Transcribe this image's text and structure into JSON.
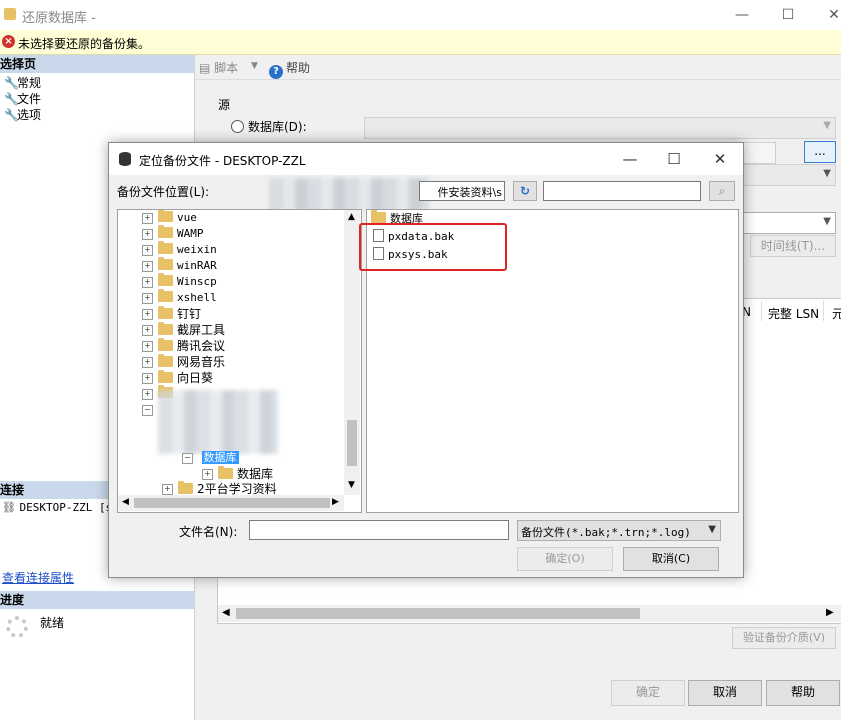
{
  "window": {
    "title": "还原数据库 -",
    "minimize": "—",
    "maximize": "☐",
    "close": "✕"
  },
  "message": {
    "text": "未选择要还原的备份集。"
  },
  "left": {
    "select_page": "选择页",
    "nav": [
      {
        "label": "常规"
      },
      {
        "label": "文件"
      },
      {
        "label": "选项"
      }
    ],
    "connection": "连接",
    "server": "DESKTOP-ZZL [s",
    "view_conn_props": "查看连接属性",
    "progress": "进度",
    "status": "就绪"
  },
  "toolbar": {
    "script": "脚本",
    "help": "帮助"
  },
  "source": {
    "label": "源",
    "database_radio": "数据库(D):",
    "browse": "...",
    "timeline": "时间线(T)...",
    "col_n": "N",
    "col_full_lsn": "完整 LSN",
    "col_more": "元",
    "verify": "验证备份介质(V)"
  },
  "footer": {
    "ok": "确定",
    "cancel": "取消",
    "help": "帮助"
  },
  "dialog": {
    "title": "定位备份文件 - DESKTOP-ZZL",
    "location_label": "备份文件位置(L):",
    "path": "件安装资料\\s",
    "tree": [
      {
        "label": "vue",
        "mono": true
      },
      {
        "label": "WAMP",
        "mono": true
      },
      {
        "label": "weixin",
        "mono": true
      },
      {
        "label": "winRAR",
        "mono": true
      },
      {
        "label": "Winscp",
        "mono": true
      },
      {
        "label": "xshell",
        "mono": true
      },
      {
        "label": "钉钉",
        "mono": false
      },
      {
        "label": "截屏工具",
        "mono": false
      },
      {
        "label": "腾讯会议",
        "mono": false
      },
      {
        "label": "网易音乐",
        "mono": false
      },
      {
        "label": "向日葵",
        "mono": false
      }
    ],
    "selected_node": "数据库",
    "child_node": "数据库",
    "sibling_node": "2平台学习资料",
    "list_header": "数据库",
    "files": [
      "pxdata.bak",
      "pxsys.bak"
    ],
    "filename_label": "文件名(N):",
    "filename_value": "",
    "filter": "备份文件(*.bak;*.trn;*.log)",
    "ok": "确定(O)",
    "cancel": "取消(C)"
  }
}
